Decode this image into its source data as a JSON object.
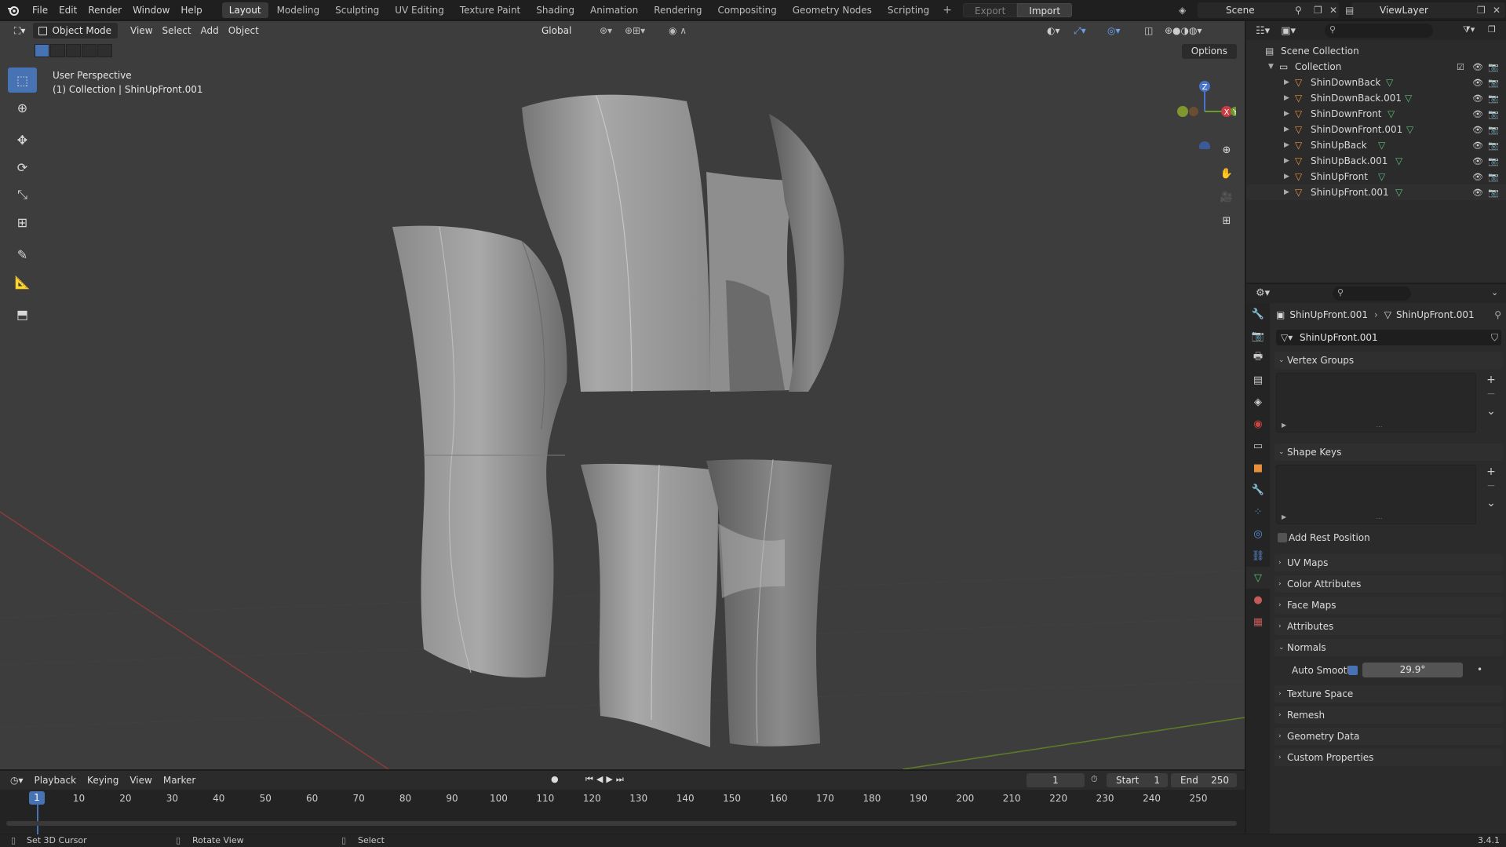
{
  "topbar": {
    "menus": [
      "File",
      "Edit",
      "Render",
      "Window",
      "Help"
    ],
    "workspaces": [
      "Layout",
      "Modeling",
      "Sculpting",
      "UV Editing",
      "Texture Paint",
      "Shading",
      "Animation",
      "Rendering",
      "Compositing",
      "Geometry Nodes",
      "Scripting"
    ],
    "active_workspace": "Layout",
    "export_label": "Export",
    "import_label": "Import",
    "scene_name": "Scene",
    "view_layer": "ViewLayer"
  },
  "viewport": {
    "mode": "Object Mode",
    "menus": [
      "View",
      "Select",
      "Add",
      "Object"
    ],
    "orientation": "Global",
    "options_label": "Options",
    "info_line1": "User Perspective",
    "info_line2": "(1) Collection | ShinUpFront.001",
    "gizmo_axes": {
      "x": "X",
      "y": "Y",
      "z": "Z"
    },
    "colors": {
      "background": "#3d3d3d",
      "x_axis": "#9b3a3a",
      "y_axis": "#6a8a2c",
      "active": "#4772b3"
    }
  },
  "outliner": {
    "scene_collection": "Scene Collection",
    "collection": "Collection",
    "objects": [
      "ShinDownBack",
      "ShinDownBack.001",
      "ShinDownFront",
      "ShinDownFront.001",
      "ShinUpBack",
      "ShinUpBack.001",
      "ShinUpFront",
      "ShinUpFront.001"
    ]
  },
  "properties": {
    "breadcrumb_object": "ShinUpFront.001",
    "breadcrumb_data": "ShinUpFront.001",
    "mesh_name": "ShinUpFront.001",
    "panels": {
      "vertex_groups": "Vertex Groups",
      "shape_keys": "Shape Keys",
      "add_rest_position": "Add Rest Position",
      "uv_maps": "UV Maps",
      "color_attributes": "Color Attributes",
      "face_maps": "Face Maps",
      "attributes": "Attributes",
      "normals": "Normals",
      "auto_smooth": "Auto Smooth",
      "auto_smooth_angle": "29.9°",
      "texture_space": "Texture Space",
      "remesh": "Remesh",
      "geometry_data": "Geometry Data",
      "custom_properties": "Custom Properties"
    }
  },
  "timeline": {
    "menus": [
      "Playback",
      "Keying",
      "View",
      "Marker"
    ],
    "current_frame": "1",
    "start_label": "Start",
    "start_value": "1",
    "end_label": "End",
    "end_value": "250",
    "ruler": [
      "1",
      "10",
      "20",
      "30",
      "40",
      "50",
      "60",
      "70",
      "80",
      "90",
      "100",
      "110",
      "120",
      "130",
      "140",
      "150",
      "160",
      "170",
      "180",
      "190",
      "200",
      "210",
      "220",
      "230",
      "240",
      "250"
    ]
  },
  "statusbar": {
    "item1": "Set 3D Cursor",
    "item2": "Rotate View",
    "item3": "Select",
    "version": "3.4.1"
  }
}
